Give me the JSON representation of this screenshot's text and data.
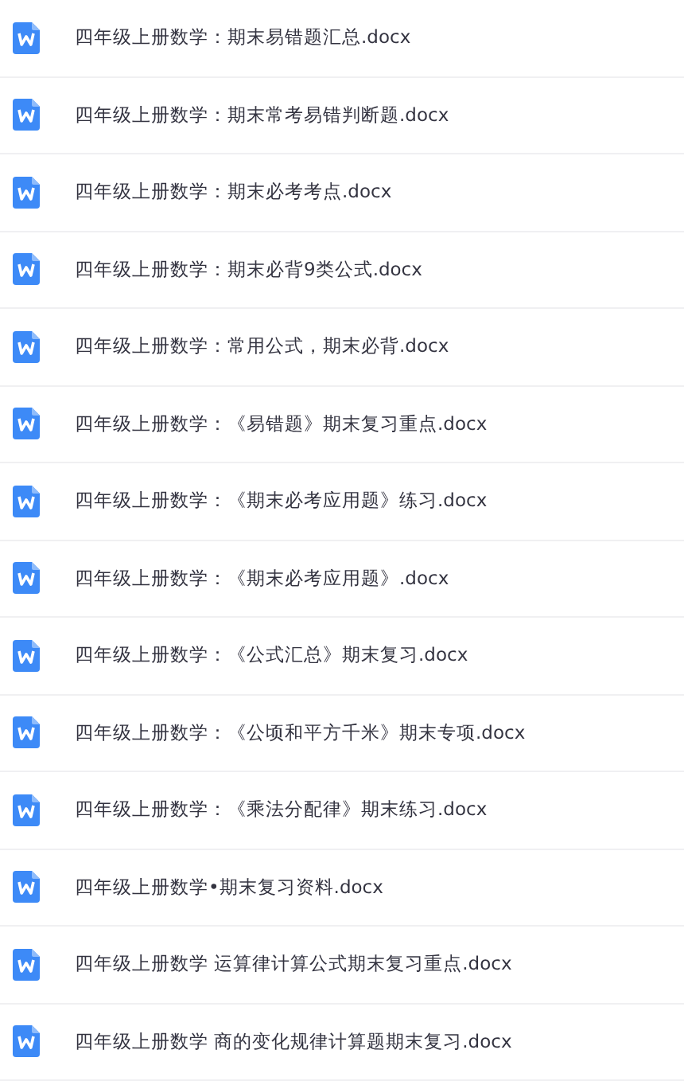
{
  "files": [
    {
      "name": "四年级上册数学：期末易错题汇总.docx"
    },
    {
      "name": "四年级上册数学：期末常考易错判断题.docx"
    },
    {
      "name": "四年级上册数学：期末必考考点.docx"
    },
    {
      "name": "四年级上册数学：期末必背9类公式.docx"
    },
    {
      "name": "四年级上册数学：常用公式，期末必背.docx"
    },
    {
      "name": "四年级上册数学：《易错题》期末复习重点.docx"
    },
    {
      "name": "四年级上册数学：《期末必考应用题》练习.docx"
    },
    {
      "name": "四年级上册数学：《期末必考应用题》.docx"
    },
    {
      "name": "四年级上册数学：《公式汇总》期末复习.docx"
    },
    {
      "name": "四年级上册数学：《公顷和平方千米》期末专项.docx"
    },
    {
      "name": "四年级上册数学：《乘法分配律》期末练习.docx"
    },
    {
      "name": "四年级上册数学•期末复习资料.docx"
    },
    {
      "name": "四年级上册数学 运算律计算公式期末复习重点.docx"
    },
    {
      "name": "四年级上册数学 商的变化规律计算题期末复习.docx"
    }
  ]
}
